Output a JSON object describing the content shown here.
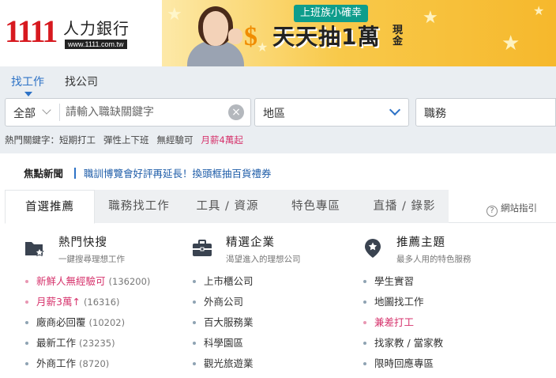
{
  "brand": {
    "logo_number": "1111",
    "logo_name": "人力銀行",
    "logo_url": "www.1111.com.tw"
  },
  "banner": {
    "tag": "上班族小確幸",
    "title": "天天抽1萬",
    "sub": "現金"
  },
  "search": {
    "tabs": [
      "找工作",
      "找公司"
    ],
    "type_label": "全部",
    "keyword_placeholder": "請輸入職缺關鍵字",
    "area_label": "地區",
    "job_label": "職務"
  },
  "hot_keywords": {
    "label": "熱門關鍵字：",
    "items": [
      "短期打工",
      "彈性上下班",
      "無經驗可",
      "月薪4萬起"
    ]
  },
  "focus_news": {
    "title": "焦點新聞",
    "link": "職訓博覽會好評再延長！換頭框抽百貨禮券"
  },
  "category_tabs": [
    "首選推薦",
    "職務找工作",
    "工具 / 資源",
    "特色專區",
    "直播 / 錄影"
  ],
  "site_guide": "網站指引",
  "columns": [
    {
      "title": "熱門快搜",
      "subtitle": "一鍵搜尋理想工作",
      "items": [
        {
          "label": "新鮮人無經驗可",
          "count": "(136200)"
        },
        {
          "label": "月薪3萬↑",
          "count": "(16316)"
        },
        {
          "label": "廠商必回覆",
          "count": "(10202)"
        },
        {
          "label": "最新工作",
          "count": "(23235)"
        },
        {
          "label": "外商工作",
          "count": "(8720)"
        }
      ]
    },
    {
      "title": "精選企業",
      "subtitle": "渴望進入的理想公司",
      "items": [
        {
          "label": "上市櫃公司"
        },
        {
          "label": "外商公司"
        },
        {
          "label": "百大服務業"
        },
        {
          "label": "科學園區"
        },
        {
          "label": "觀光旅遊業"
        }
      ]
    },
    {
      "title": "推薦主題",
      "subtitle": "最多人用的特色服務",
      "items": [
        {
          "label": "學生實習"
        },
        {
          "label": "地圖找工作"
        },
        {
          "label": "兼差打工"
        },
        {
          "label": "找家教 / 當家教"
        },
        {
          "label": "限時回應專區"
        }
      ]
    }
  ],
  "colors": {
    "brand_red": "#d7191f",
    "link_blue": "#2d72c6",
    "highlight_pink": "#d6336c"
  }
}
